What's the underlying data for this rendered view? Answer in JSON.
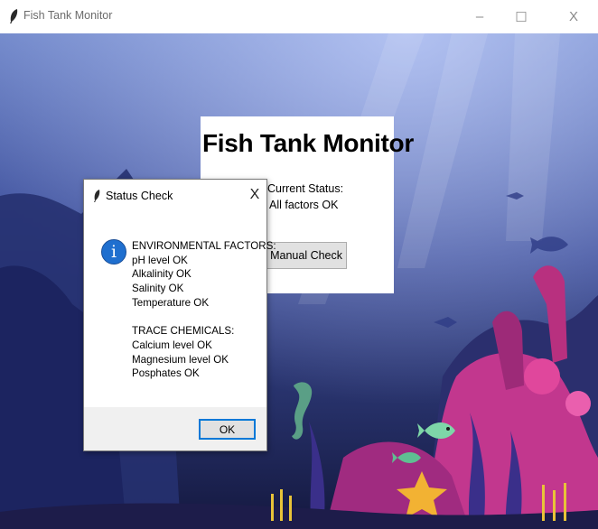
{
  "window": {
    "title": "Fish Tank Monitor",
    "controls": {
      "minimize": "–",
      "maximize": "☐",
      "close": "X"
    }
  },
  "main": {
    "heading": "Fish Tank Monitor",
    "status_label": "Current Status:",
    "status_value": "All factors OK",
    "manual_check_button": "Perform Manual Check"
  },
  "dialog": {
    "title": "Status Check",
    "close_label": "X",
    "icon": "info-icon",
    "icon_glyph": "i",
    "message": "ENVIRONMENTAL FACTORS:\npH level OK\nAlkalinity OK\nSalinity OK\nTemperature OK\n\nTRACE CHEMICALS:\nCalcium level OK\nMagnesium level OK\nPosphates OK",
    "ok_button": "OK"
  },
  "colors": {
    "accent": "#0078d7",
    "info_icon": "#1f6fcf",
    "sea_top": "#6f86c9",
    "sea_bottom": "#14183f"
  }
}
